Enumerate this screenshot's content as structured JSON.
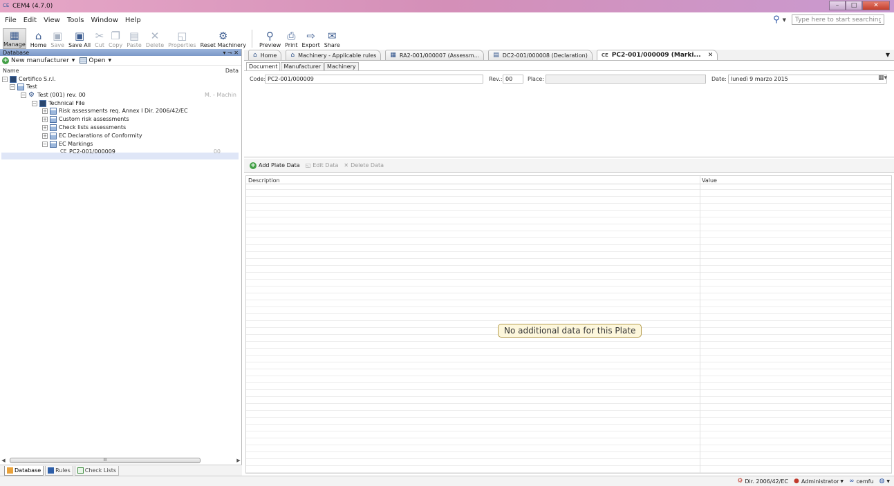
{
  "window": {
    "title": "CEM4 (4.7.0)",
    "title_icon": "ce-logo-icon"
  },
  "menu": [
    "File",
    "Edit",
    "View",
    "Tools",
    "Window",
    "Help"
  ],
  "search": {
    "placeholder": "Type here to start searching"
  },
  "toolbar": {
    "manage": "Manage",
    "home": "Home",
    "save": "Save",
    "save_all": "Save All",
    "cut": "Cut",
    "copy": "Copy",
    "paste": "Paste",
    "delete": "Delete",
    "properties": "Properties",
    "reset_machinery": "Reset Machinery",
    "preview": "Preview",
    "print": "Print",
    "export": "Export",
    "share": "Share"
  },
  "left_panel": {
    "title": "Database",
    "new_manufacturer": "New manufacturer",
    "open": "Open",
    "col_name": "Name",
    "col_data": "Data",
    "tree": {
      "certifico": "Certifico S.r.l.",
      "test": "Test",
      "test_rev": "Test (001) rev. 00",
      "test_rev_data": "M. - Machin",
      "technical_file": "Technical File",
      "risk": "Risk assessments req. Annex I Dir. 2006/42/EC",
      "custom_risk": "Custom risk assessments",
      "check_lists": "Check lists assessments",
      "ec_decl": "EC Declarations of Conformity",
      "ec_markings": "EC Markings",
      "pc2": "PC2-001/000009",
      "pc2_data": "00"
    },
    "scroll_thumb": "III",
    "bottom_tabs": {
      "database": "Database",
      "rules": "Rules",
      "check_lists": "Check Lists"
    }
  },
  "doc_tabs": {
    "home": "Home",
    "machinery": "Machinery - Applicable rules",
    "ra2": "RA2-001/000007 (Assessm...",
    "dc2": "DC2-001/000008 (Declaration)",
    "pc2": "PC2-001/000009 (Marki..."
  },
  "sub_tabs": {
    "document": "Document",
    "manufacturer": "Manufacturer",
    "machinery": "Machinery"
  },
  "form": {
    "code_label": "Code:",
    "code_value": "PC2-001/000009",
    "rev_label": "Rev.:",
    "rev_value": "00",
    "place_label": "Place:",
    "place_value": "",
    "date_label": "Date:",
    "date_value": "lunedì 9 marzo 2015"
  },
  "data_toolbar": {
    "add": "Add Plate Data",
    "edit": "Edit Data",
    "delete": "Delete Data"
  },
  "grid": {
    "col_description": "Description",
    "col_value": "Value",
    "empty_message": "No additional data for this Plate"
  },
  "status": {
    "directive": "Dir. 2006/42/EC",
    "user": "Administrator",
    "login": "cemfu"
  }
}
